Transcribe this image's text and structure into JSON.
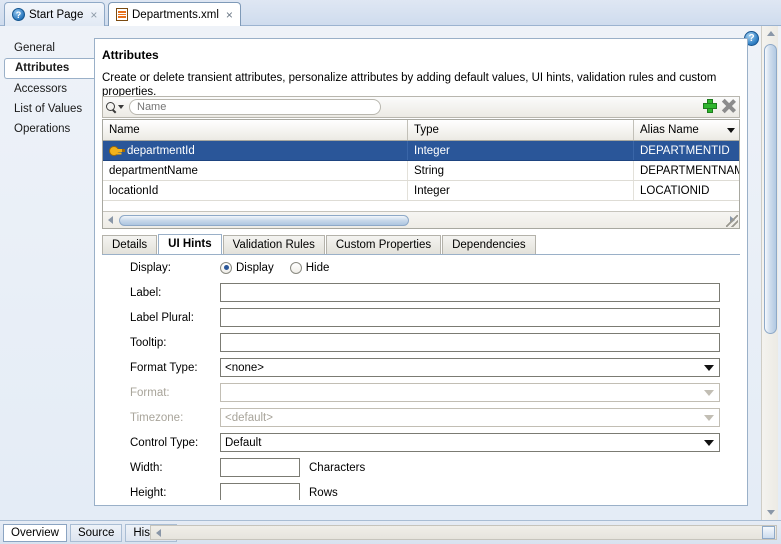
{
  "window": {
    "editor_tabs": [
      {
        "label": "Start Page",
        "icon": "help-icon",
        "close": "×",
        "active": false
      },
      {
        "label": "Departments.xml",
        "icon": "xml-file-icon",
        "close": "×",
        "active": true
      }
    ],
    "help_glyph": "?"
  },
  "sidebar": {
    "items": [
      {
        "label": "General",
        "active": false
      },
      {
        "label": "Attributes",
        "active": true
      },
      {
        "label": "Accessors",
        "active": false
      },
      {
        "label": "List of Values",
        "active": false
      },
      {
        "label": "Operations",
        "active": false
      }
    ]
  },
  "main": {
    "title": "Attributes",
    "description": "Create or delete transient attributes, personalize attributes by adding default values, UI hints, validation rules and custom properties.",
    "toolbar": {
      "search_placeholder": "Name",
      "search_value": "",
      "add_label": "+",
      "delete_label": "×"
    },
    "table": {
      "columns": [
        "Name",
        "Type",
        "Alias Name"
      ],
      "rows": [
        {
          "name": "departmentId",
          "type": "Integer",
          "alias": "DEPARTMENTID",
          "key": true,
          "selected": true
        },
        {
          "name": "departmentName",
          "type": "String",
          "alias": "DEPARTMENTNAME",
          "key": false,
          "selected": false
        },
        {
          "name": "locationId",
          "type": "Integer",
          "alias": "LOCATIONID",
          "key": false,
          "selected": false
        }
      ]
    },
    "detail_tabs": [
      {
        "label": "Details",
        "active": false
      },
      {
        "label": "UI Hints",
        "active": true
      },
      {
        "label": "Validation Rules",
        "active": false
      },
      {
        "label": "Custom Properties",
        "active": false
      },
      {
        "label": "Dependencies",
        "active": false
      }
    ],
    "form": {
      "display_label": "Display:",
      "display_option": "Display",
      "hide_option": "Hide",
      "label_label": "Label:",
      "label_value": "",
      "label_plural_label": "Label Plural:",
      "label_plural_value": "",
      "tooltip_label": "Tooltip:",
      "tooltip_value": "",
      "format_type_label": "Format Type:",
      "format_type_value": "<none>",
      "format_label": "Format:",
      "format_value": "",
      "timezone_label": "Timezone:",
      "timezone_value": "<default>",
      "control_type_label": "Control Type:",
      "control_type_value": "Default",
      "width_label": "Width:",
      "width_value": "",
      "width_unit": "Characters",
      "height_label": "Height:",
      "height_value": "",
      "height_unit": "Rows"
    }
  },
  "bottom": {
    "tabs": [
      {
        "label": "Overview",
        "active": true
      },
      {
        "label": "Source",
        "active": false
      },
      {
        "label": "History",
        "active": false
      }
    ]
  }
}
